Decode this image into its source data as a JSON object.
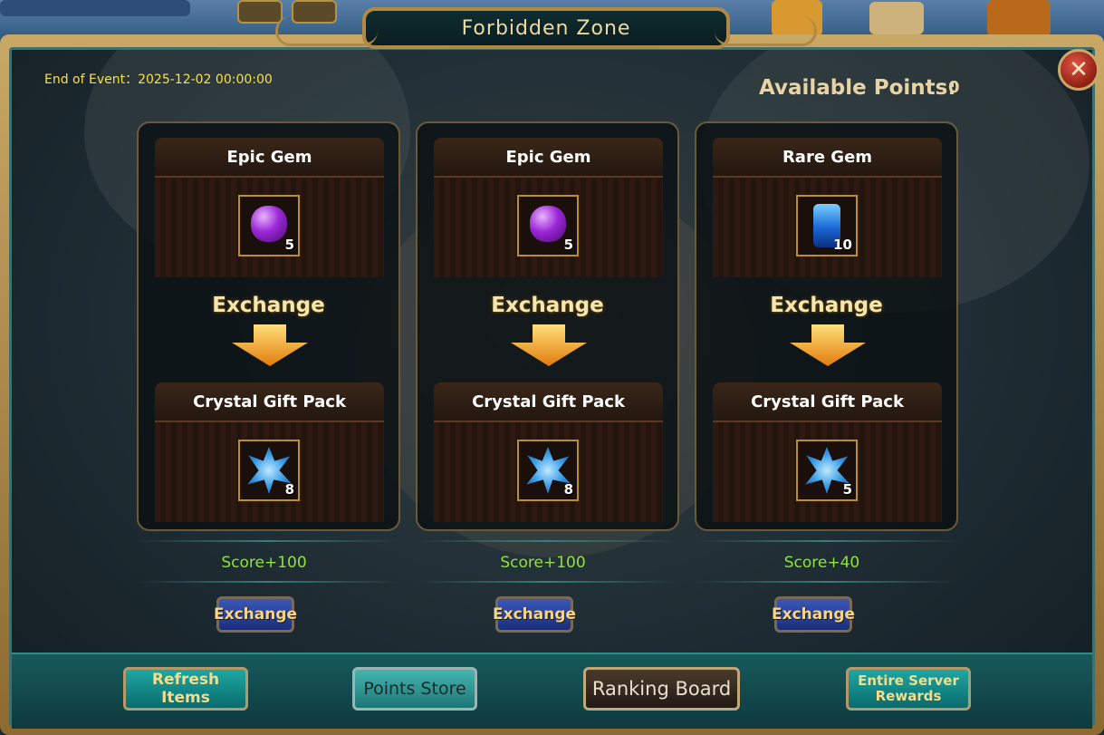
{
  "window": {
    "title": "Forbidden Zone",
    "close_icon": "close-icon"
  },
  "event": {
    "end_label": "End of Event：2025-12-02 00:00:00"
  },
  "points": {
    "label": "Available Points:",
    "value": "0"
  },
  "exchanges": [
    {
      "cost_name": "Epic Gem",
      "cost_icon": "epic-gem-icon",
      "cost_qty": "5",
      "arrow_label": "Exchange",
      "reward_name": "Crystal Gift Pack",
      "reward_icon": "crystal-icon",
      "reward_qty": "8",
      "score": "Score+100",
      "button": "Exchange"
    },
    {
      "cost_name": "Epic Gem",
      "cost_icon": "epic-gem-icon",
      "cost_qty": "5",
      "arrow_label": "Exchange",
      "reward_name": "Crystal Gift Pack",
      "reward_icon": "crystal-icon",
      "reward_qty": "8",
      "score": "Score+100",
      "button": "Exchange"
    },
    {
      "cost_name": "Rare Gem",
      "cost_icon": "rare-gem-icon",
      "cost_qty": "10",
      "arrow_label": "Exchange",
      "reward_name": "Crystal Gift Pack",
      "reward_icon": "crystal-icon",
      "reward_qty": "5",
      "score": "Score+40",
      "button": "Exchange"
    }
  ],
  "footer": {
    "refresh": "Refresh Items",
    "store": "Points Store",
    "ranking": "Ranking Board",
    "entire_line1": "Entire Server",
    "entire_line2": "Rewards"
  },
  "colors": {
    "score_green": "#8fe33a",
    "event_yellow": "#f5e04a",
    "frame_gold": "#c9a865"
  }
}
